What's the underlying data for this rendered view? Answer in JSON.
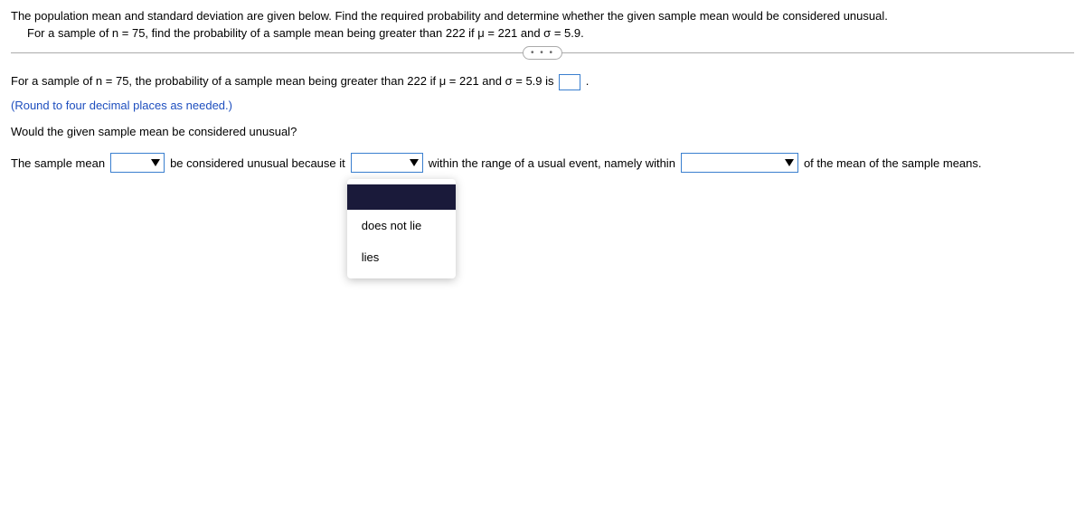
{
  "question": {
    "line1": "The population mean and standard deviation are given below. Find the required probability and determine whether the given sample mean would be considered unusual.",
    "line2": "For a sample of n = 75, find the probability of a sample mean being greater than 222 if μ = 221 and σ = 5.9."
  },
  "divider_label": "• • •",
  "answer": {
    "prompt": "For a sample of n = 75, the probability of a sample mean being greater than 222 if μ = 221 and σ = 5.9 is ",
    "period": ".",
    "note": "(Round to four decimal places as needed.)"
  },
  "unusual_question": "Would the given sample mean be considered unusual?",
  "fill": {
    "part1": "The sample mean",
    "part2": "be considered unusual because it",
    "part3": "within the range of a usual event, namely within",
    "part4": "of the mean of the sample means."
  },
  "dropdown_menu": {
    "blank": " ",
    "option1": "does not lie",
    "option2": "lies"
  }
}
